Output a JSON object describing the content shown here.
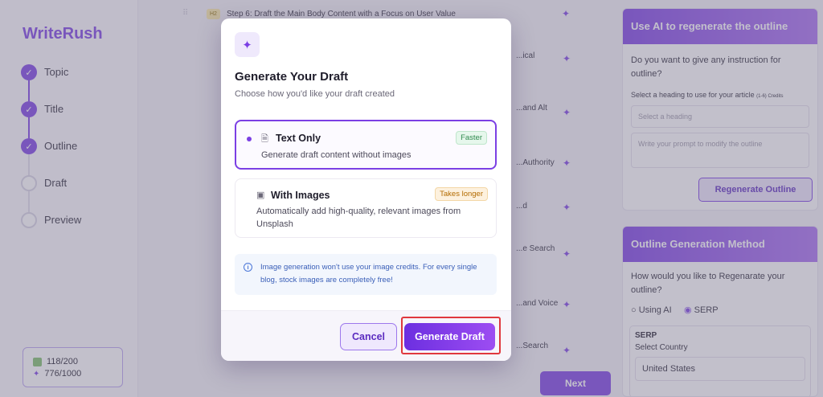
{
  "app": {
    "name": "WriteRush"
  },
  "sidebar": {
    "steps": [
      {
        "label": "Topic",
        "done": true
      },
      {
        "label": "Title",
        "done": true
      },
      {
        "label": "Outline",
        "done": true
      },
      {
        "label": "Draft",
        "done": false
      },
      {
        "label": "Preview",
        "done": false
      }
    ],
    "credits": {
      "words": "118/200",
      "sparks": "776/1000"
    }
  },
  "outline": {
    "step_tag": "H2",
    "top_row": "Step 6: Draft the Main Body Content with a Focus on User Value",
    "fragments": [
      "...ical",
      "...and Alt",
      "...Authority",
      "...d",
      "...e Search",
      "...and Voice",
      "...Search"
    ],
    "next_label": "Next"
  },
  "right_panel": {
    "ai_title": "Use AI to regenerate the outline",
    "ai_question": "Do you want to give any instruction for outline?",
    "heading_label": "Select a heading to use for your article",
    "heading_note": "(1-6) Credits",
    "heading_placeholder": "Select a heading",
    "prompt_placeholder": "Write your prompt to modify the outline",
    "regenerate_label": "Regenerate Outline",
    "method_title": "Outline Generation Method",
    "method_question": "How would you like to Regenarate your outline?",
    "opt_ai": "Using AI",
    "opt_serp": "SERP",
    "serp_label": "SERP",
    "country_label": "Select Country",
    "country_value": "United States"
  },
  "modal": {
    "title": "Generate Your Draft",
    "subtitle": "Choose how you'd like your draft created",
    "options": [
      {
        "label": "Text Only",
        "description": "Generate draft content without images",
        "badge": "Faster",
        "selected": true
      },
      {
        "label": "With Images",
        "description": "Automatically add high-quality, relevant images from Unsplash",
        "badge": "Takes longer",
        "selected": false
      }
    ],
    "info": "Image generation won't use your image credits. For every single blog, stock images are completely free!",
    "cancel_label": "Cancel",
    "generate_label": "Generate Draft"
  },
  "colors": {
    "accent": "#7b3fe4",
    "highlight": "#e0383e"
  }
}
